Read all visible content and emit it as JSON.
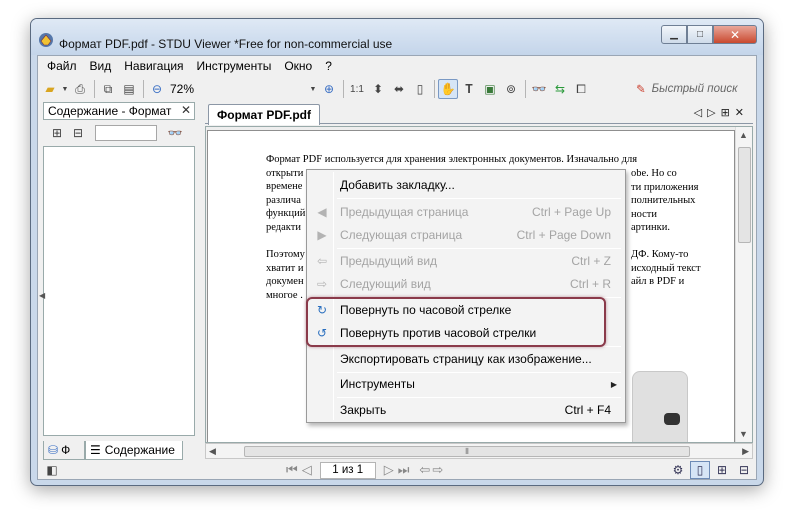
{
  "window": {
    "title": "Формат PDF.pdf - STDU Viewer *Free for non-commercial use"
  },
  "menubar": {
    "items": [
      {
        "label": "Файл"
      },
      {
        "label": "Вид"
      },
      {
        "label": "Навигация"
      },
      {
        "label": "Инструменты"
      },
      {
        "label": "Окно"
      },
      {
        "label": "?"
      }
    ]
  },
  "toolbar": {
    "zoom": "72%",
    "scale_1to1": "1:1",
    "search_placeholder": "Быстрый поиск"
  },
  "left_panel": {
    "title": "Содержание - Формат",
    "tabs": [
      {
        "label": "Ф"
      },
      {
        "label": "Содержание"
      }
    ]
  },
  "document": {
    "tab_label": "Формат PDF.pdf",
    "paragraph1": "Формат PDF используется для хранения электронных документов. Изначально для\nоткрыти\nвремене\nразлича\nфункций\nредакти",
    "paragraph1_right": "obe. Но со\nти приложения\nполнительных\nности\nартинки.",
    "paragraph2": "Поэтому\nхватит и\nдокумен\nмногое .",
    "paragraph2_right": "ДФ. Кому-то\nисходный текст\nайл в PDF и"
  },
  "statusbar": {
    "page_indicator": "1 из 1"
  },
  "context_menu": {
    "items": [
      {
        "label": "Добавить закладку...",
        "shortcut": "",
        "disabled": false,
        "icon": ""
      },
      {
        "label": "Предыдущая страница",
        "shortcut": "Ctrl + Page Up",
        "disabled": true,
        "icon": "◀"
      },
      {
        "label": "Следующая страница",
        "shortcut": "Ctrl + Page Down",
        "disabled": true,
        "icon": "▶"
      },
      {
        "label": "Предыдущий вид",
        "shortcut": "Ctrl + Z",
        "disabled": true,
        "icon": "⇦"
      },
      {
        "label": "Следующий вид",
        "shortcut": "Ctrl + R",
        "disabled": true,
        "icon": "⇨"
      },
      {
        "label": "Повернуть по часовой стрелке",
        "shortcut": "",
        "disabled": false,
        "icon": "↻"
      },
      {
        "label": "Повернуть против часовой стрелки",
        "shortcut": "",
        "disabled": false,
        "icon": "↺"
      },
      {
        "label": "Экспортировать страницу как изображение...",
        "shortcut": "",
        "disabled": false,
        "icon": ""
      },
      {
        "label": "Инструменты",
        "shortcut": "",
        "disabled": false,
        "icon": ""
      },
      {
        "label": "Закрыть",
        "shortcut": "Ctrl + F4",
        "disabled": false,
        "icon": ""
      }
    ]
  },
  "colors": {
    "highlight_border": "#8a3a4a",
    "title_gradient_top": "#dfe9f5",
    "close_button": "#c9492f"
  }
}
